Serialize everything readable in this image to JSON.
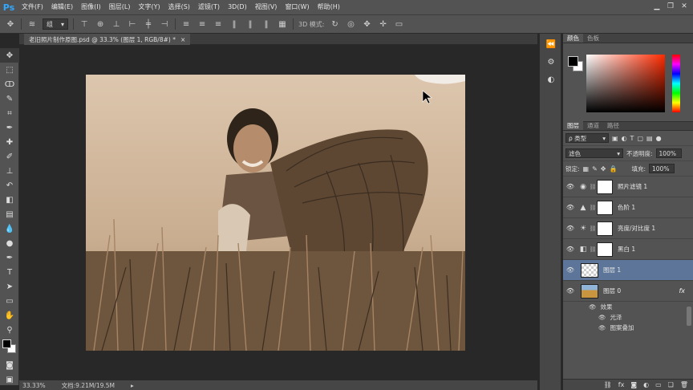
{
  "app": {
    "logo": "Ps"
  },
  "menu": [
    "文件(F)",
    "编辑(E)",
    "图像(I)",
    "图层(L)",
    "文字(Y)",
    "选择(S)",
    "滤镜(T)",
    "3D(D)",
    "视图(V)",
    "窗口(W)",
    "帮助(H)"
  ],
  "options": {
    "auto_select_value": "组",
    "mode_3d_label": "3D 模式:"
  },
  "document": {
    "tab_title": "老旧照片制作原图.psd @ 33.3% (图层 1, RGB/8#) *",
    "close_glyph": "×"
  },
  "status": {
    "zoom": "33.33%",
    "doc_size": "文档:9.21M/19.5M"
  },
  "color_panel": {
    "tabs": [
      "颜色",
      "色板"
    ]
  },
  "layers_panel": {
    "tabs": [
      "图层",
      "通道",
      "路径"
    ],
    "filter_label": "ρ 类型",
    "blend_mode": "滤色",
    "opacity_label": "不透明度:",
    "opacity_value": "100%",
    "lock_label": "锁定:",
    "fill_label": "填充:",
    "fill_value": "100%",
    "layers": [
      {
        "name": "照片滤镜 1",
        "icon": "photo-filter-icon"
      },
      {
        "name": "色阶 1",
        "icon": "levels-icon"
      },
      {
        "name": "亮度/对比度 1",
        "icon": "brightness-contrast-icon"
      },
      {
        "name": "黑白 1",
        "icon": "black-white-icon"
      },
      {
        "name": "图层 1",
        "selected": true
      },
      {
        "name": "图层 0",
        "fx": "fx"
      }
    ],
    "effects_label": "效果",
    "effects": [
      "光泽",
      "图案叠加"
    ]
  },
  "colors": {
    "accent": "#31a8ff",
    "selected_layer": "#5c7598",
    "panel_bg": "#535353"
  }
}
